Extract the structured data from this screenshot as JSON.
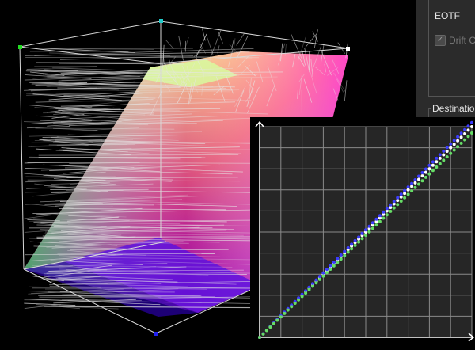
{
  "settings": {
    "eotf_label": "EOTF",
    "drift_label": "Drift Co",
    "drift_checked": true,
    "destination_label": "Destination"
  },
  "viewport": {
    "corner_colors": {
      "green": "#22dd22",
      "cyan": "#22cccc",
      "white": "#ffffff",
      "blue": "#2222ee"
    },
    "wire_color": "#d8d8d8"
  },
  "curve_graph": {
    "background": "#262626",
    "grid_color": "#8a8a8a",
    "grid_divisions": 10,
    "series": [
      {
        "color": "#ffffff",
        "values": [
          0,
          1
        ]
      },
      {
        "color": "#3b3bff",
        "values": [
          0,
          1.02
        ]
      },
      {
        "color": "#66dd66",
        "values": [
          0,
          0.97
        ]
      }
    ]
  },
  "icons": [
    "checkmark-icon",
    "arrow-up-icon",
    "arrow-right-icon"
  ]
}
